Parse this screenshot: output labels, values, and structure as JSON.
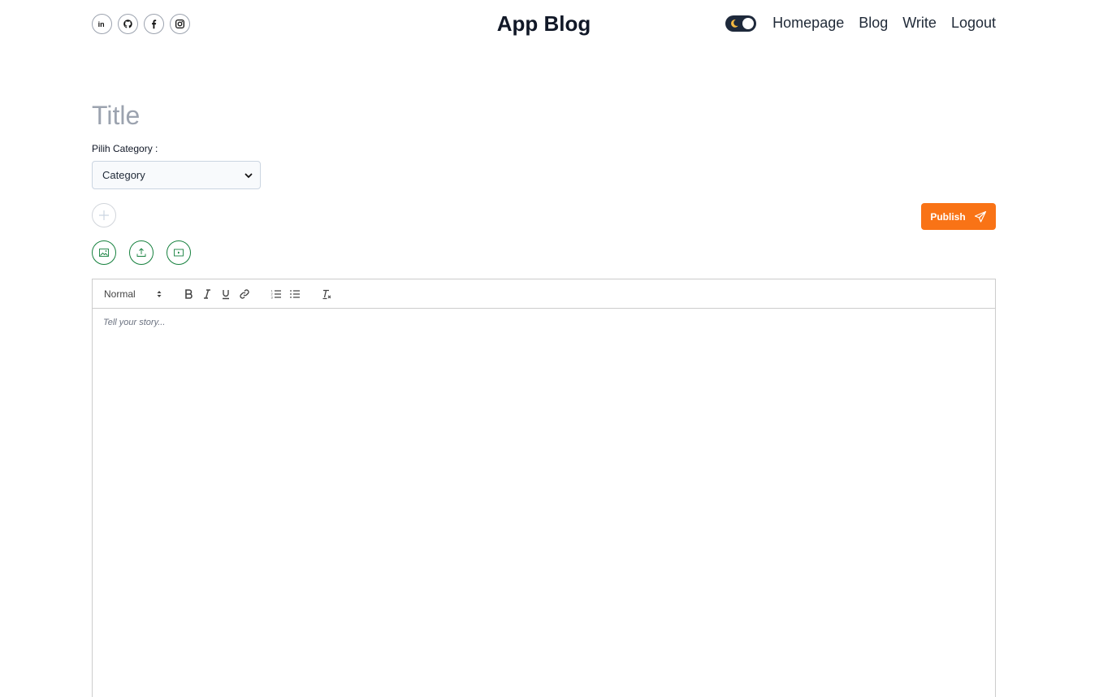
{
  "header": {
    "brand": "App Blog",
    "socials": [
      "linkedin-icon",
      "github-icon",
      "facebook-icon",
      "instagram-icon"
    ],
    "theme_toggle": "dark-mode-toggle",
    "nav": [
      {
        "label": "Homepage"
      },
      {
        "label": "Blog"
      },
      {
        "label": "Write"
      },
      {
        "label": "Logout"
      }
    ]
  },
  "form": {
    "title_placeholder": "Title",
    "category_label": "Pilih Category :",
    "category_value": "Category",
    "publish_label": "Publish"
  },
  "editor": {
    "heading_select": "Normal",
    "placeholder": "Tell your story..."
  },
  "colors": {
    "accent": "#f97316",
    "media_border": "#15803d",
    "toggle_bg": "#1e293b"
  }
}
